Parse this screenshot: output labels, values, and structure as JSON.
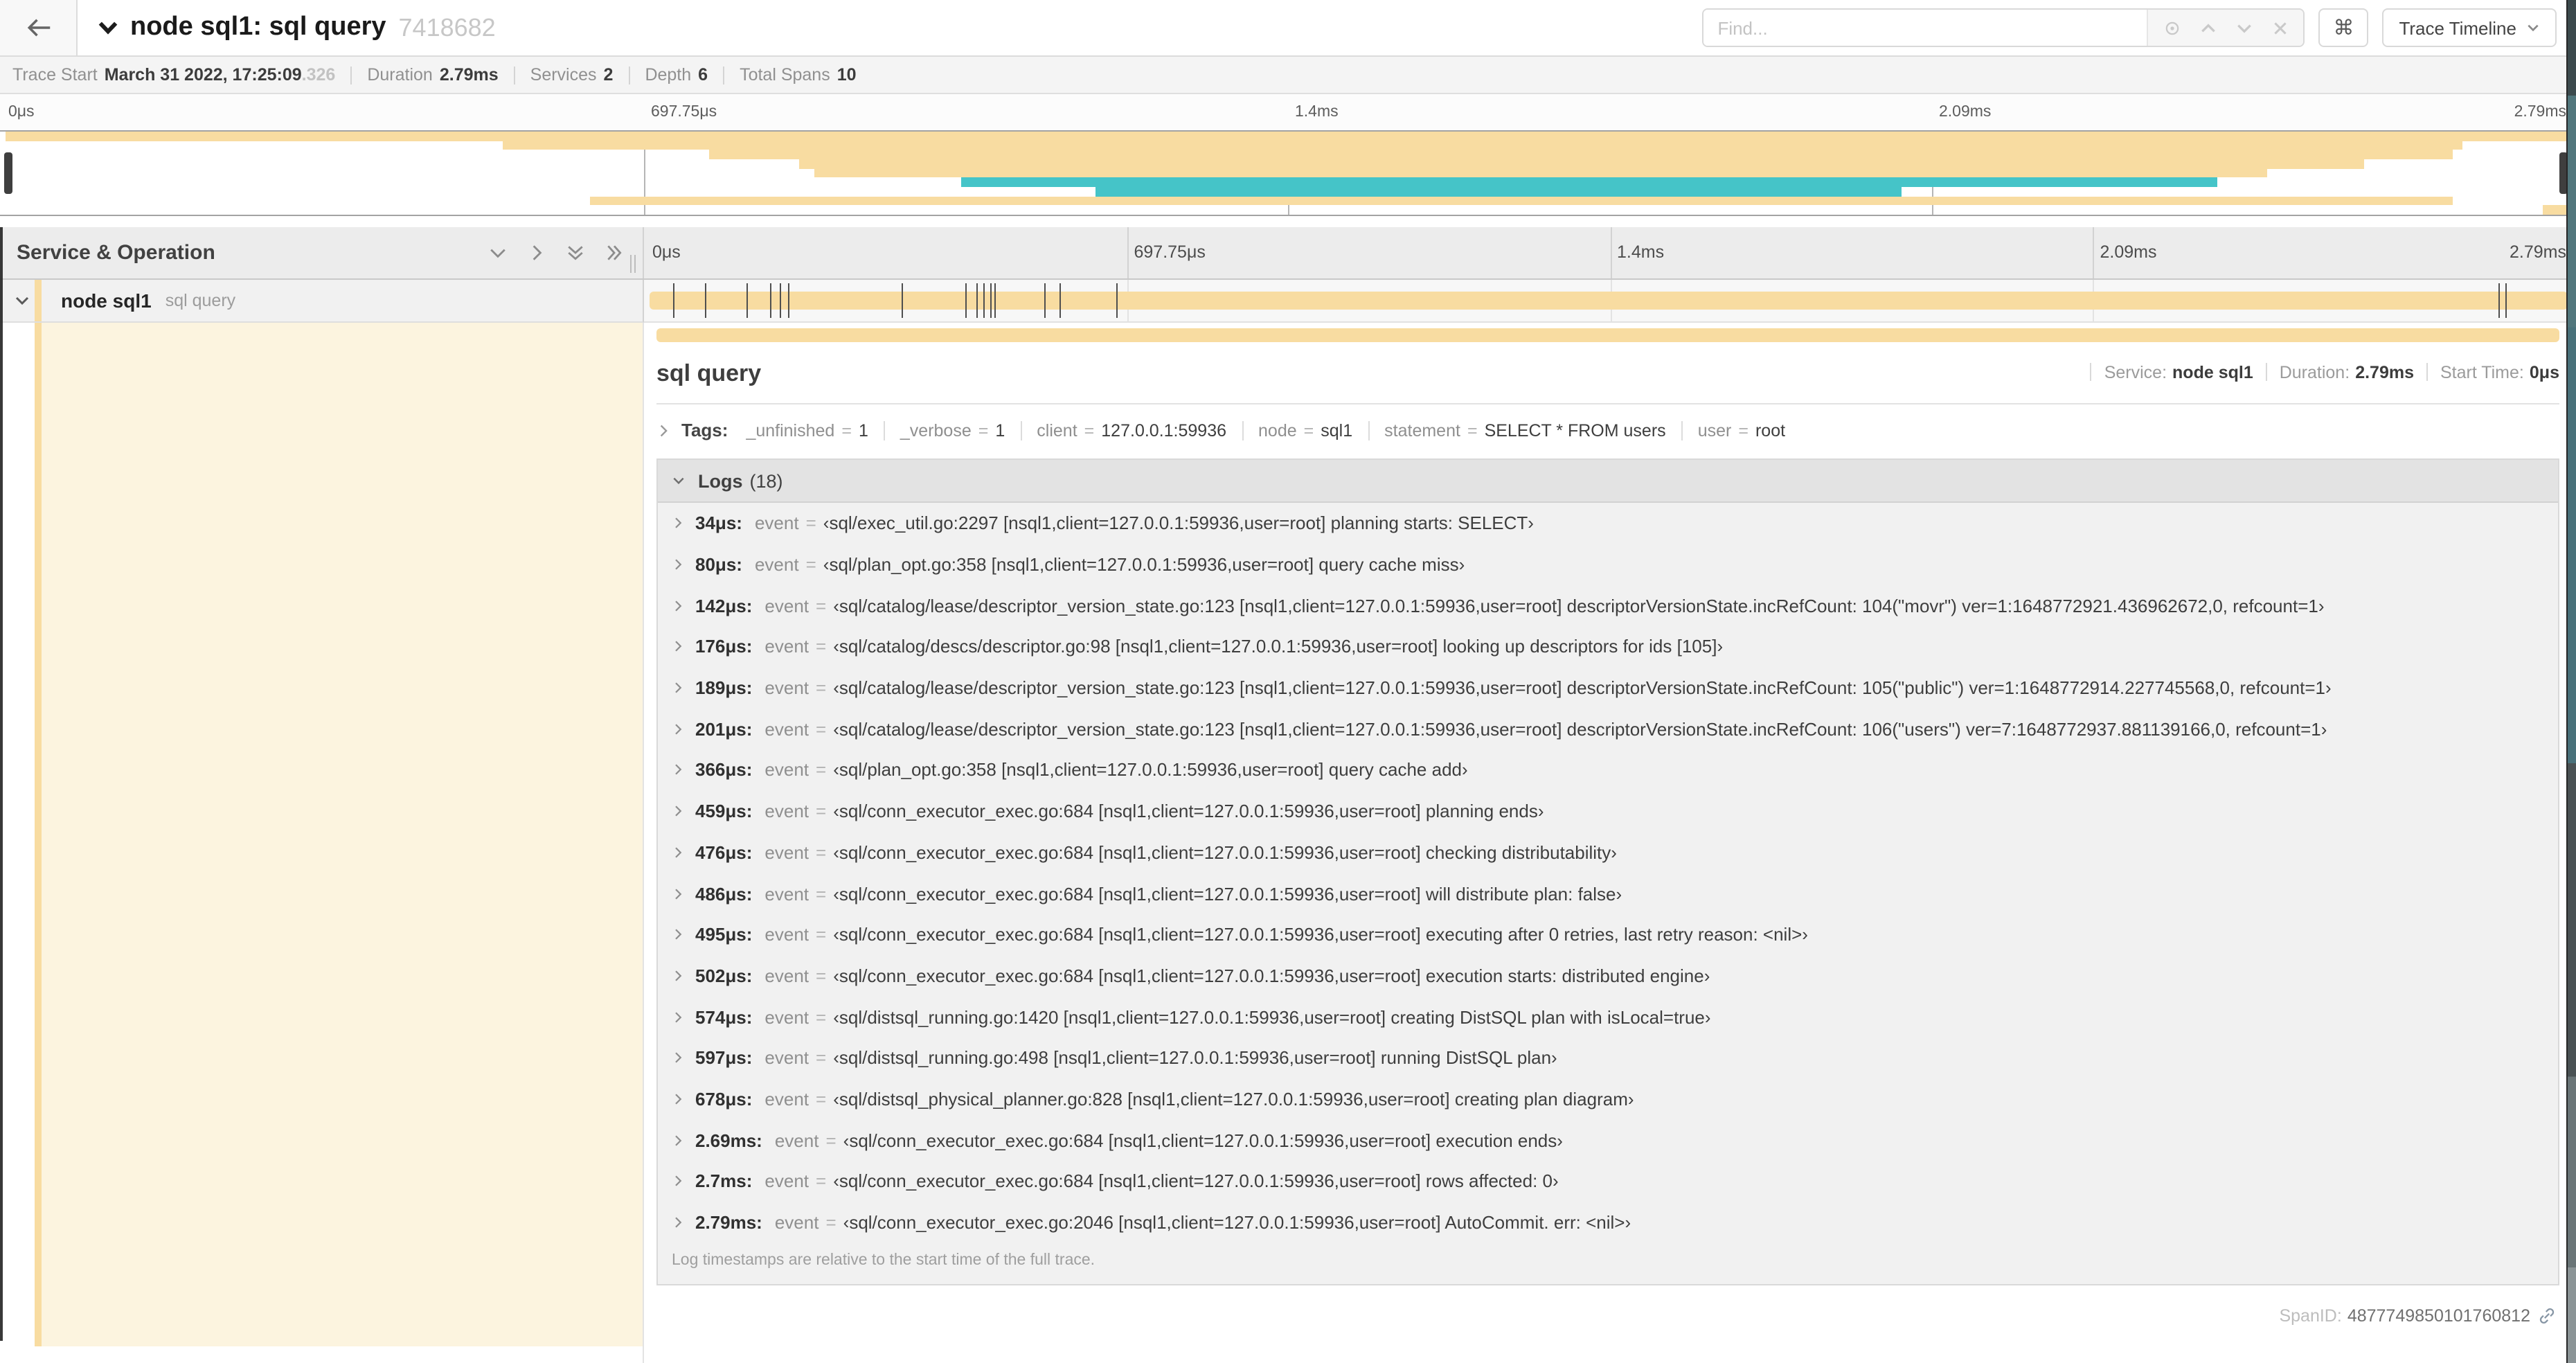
{
  "header": {
    "title_service": "node sql1: sql query",
    "trace_id_short": "7418682",
    "find_placeholder": "Find...",
    "keyboard_shortcut_label": "⌘",
    "view_selector_label": "Trace Timeline"
  },
  "summary": {
    "items": [
      {
        "label": "Trace Start",
        "value": "March 31 2022, 17:25:09",
        "suffix": ".326"
      },
      {
        "label": "Duration",
        "value": "2.79ms",
        "suffix": ""
      },
      {
        "label": "Services",
        "value": "2",
        "suffix": ""
      },
      {
        "label": "Depth",
        "value": "6",
        "suffix": ""
      },
      {
        "label": "Total Spans",
        "value": "10",
        "suffix": ""
      }
    ]
  },
  "timeline_ticks": [
    {
      "label": "0μs",
      "pct": 0
    },
    {
      "label": "697.75μs",
      "pct": 25
    },
    {
      "label": "1.4ms",
      "pct": 50
    },
    {
      "label": "2.09ms",
      "pct": 75
    },
    {
      "label": "2.79ms",
      "pct": 100
    }
  ],
  "colors": {
    "tan": "#f8dca1",
    "teal": "#45c4c8",
    "tan_faint": "#fcf4df"
  },
  "minimap": {
    "spans": [
      {
        "color": "tan",
        "start": 0.2,
        "end": 99.8
      },
      {
        "color": "tan",
        "start": 19.5,
        "end": 95.6
      },
      {
        "color": "tan",
        "start": 27.5,
        "end": 95.2
      },
      {
        "color": "tan",
        "start": 31.0,
        "end": 91.8
      },
      {
        "color": "tan",
        "start": 31.6,
        "end": 88.0
      },
      {
        "color": "teal",
        "start": 37.3,
        "end": 86.1
      },
      {
        "color": "teal",
        "start": 42.5,
        "end": 73.8
      },
      {
        "color": "tan",
        "start": 22.9,
        "end": 95.2
      },
      {
        "color": "tan",
        "start": 98.7,
        "end": 99.8
      }
    ]
  },
  "span_list": {
    "header_label": "Service & Operation",
    "row": {
      "service": "node sql1",
      "operation": "sql query"
    }
  },
  "trace": {
    "duration_us": 2790
  },
  "detail": {
    "title": "sql query",
    "meta": [
      {
        "label": "Service:",
        "value": "node sql1"
      },
      {
        "label": "Duration:",
        "value": "2.79ms"
      },
      {
        "label": "Start Time:",
        "value": "0μs"
      }
    ],
    "tags_label": "Tags:",
    "tags": [
      {
        "key": "_unfinished",
        "eq": "=",
        "value": "1"
      },
      {
        "key": "_verbose",
        "eq": "=",
        "value": "1"
      },
      {
        "key": "client",
        "eq": "=",
        "value": "127.0.0.1:59936"
      },
      {
        "key": "node",
        "eq": "=",
        "value": "sql1"
      },
      {
        "key": "statement",
        "eq": "=",
        "value": "SELECT * FROM users"
      },
      {
        "key": "user",
        "eq": "=",
        "value": "root"
      }
    ],
    "logs_label": "Logs",
    "logs_count": "(18)",
    "logs": [
      {
        "t": "34μs:",
        "t_us": 34,
        "key": "event",
        "eq": "=",
        "value": "‹sql/exec_util.go:2297 [nsql1,client=127.0.0.1:59936,user=root] planning starts: SELECT›"
      },
      {
        "t": "80μs:",
        "t_us": 80,
        "key": "event",
        "eq": "=",
        "value": "‹sql/plan_opt.go:358 [nsql1,client=127.0.0.1:59936,user=root] query cache miss›"
      },
      {
        "t": "142μs:",
        "t_us": 142,
        "key": "event",
        "eq": "=",
        "value": "‹sql/catalog/lease/descriptor_version_state.go:123 [nsql1,client=127.0.0.1:59936,user=root] descriptorVersionState.incRefCount: 104(\"movr\") ver=1:1648772921.436962672,0, refcount=1›"
      },
      {
        "t": "176μs:",
        "t_us": 176,
        "key": "event",
        "eq": "=",
        "value": "‹sql/catalog/descs/descriptor.go:98 [nsql1,client=127.0.0.1:59936,user=root] looking up descriptors for ids [105]›"
      },
      {
        "t": "189μs:",
        "t_us": 189,
        "key": "event",
        "eq": "=",
        "value": "‹sql/catalog/lease/descriptor_version_state.go:123 [nsql1,client=127.0.0.1:59936,user=root] descriptorVersionState.incRefCount: 105(\"public\") ver=1:1648772914.227745568,0, refcount=1›"
      },
      {
        "t": "201μs:",
        "t_us": 201,
        "key": "event",
        "eq": "=",
        "value": "‹sql/catalog/lease/descriptor_version_state.go:123 [nsql1,client=127.0.0.1:59936,user=root] descriptorVersionState.incRefCount: 106(\"users\") ver=7:1648772937.881139166,0, refcount=1›"
      },
      {
        "t": "366μs:",
        "t_us": 366,
        "key": "event",
        "eq": "=",
        "value": "‹sql/plan_opt.go:358 [nsql1,client=127.0.0.1:59936,user=root] query cache add›"
      },
      {
        "t": "459μs:",
        "t_us": 459,
        "key": "event",
        "eq": "=",
        "value": "‹sql/conn_executor_exec.go:684 [nsql1,client=127.0.0.1:59936,user=root] planning ends›"
      },
      {
        "t": "476μs:",
        "t_us": 476,
        "key": "event",
        "eq": "=",
        "value": "‹sql/conn_executor_exec.go:684 [nsql1,client=127.0.0.1:59936,user=root] checking distributability›"
      },
      {
        "t": "486μs:",
        "t_us": 486,
        "key": "event",
        "eq": "=",
        "value": "‹sql/conn_executor_exec.go:684 [nsql1,client=127.0.0.1:59936,user=root] will distribute plan: false›"
      },
      {
        "t": "495μs:",
        "t_us": 495,
        "key": "event",
        "eq": "=",
        "value": "‹sql/conn_executor_exec.go:684 [nsql1,client=127.0.0.1:59936,user=root] executing after 0 retries, last retry reason: <nil>›"
      },
      {
        "t": "502μs:",
        "t_us": 502,
        "key": "event",
        "eq": "=",
        "value": "‹sql/conn_executor_exec.go:684 [nsql1,client=127.0.0.1:59936,user=root] execution starts: distributed engine›"
      },
      {
        "t": "574μs:",
        "t_us": 574,
        "key": "event",
        "eq": "=",
        "value": "‹sql/distsql_running.go:1420 [nsql1,client=127.0.0.1:59936,user=root] creating DistSQL plan with isLocal=true›"
      },
      {
        "t": "597μs:",
        "t_us": 597,
        "key": "event",
        "eq": "=",
        "value": "‹sql/distsql_running.go:498 [nsql1,client=127.0.0.1:59936,user=root] running DistSQL plan›"
      },
      {
        "t": "678μs:",
        "t_us": 678,
        "key": "event",
        "eq": "=",
        "value": "‹sql/distsql_physical_planner.go:828 [nsql1,client=127.0.0.1:59936,user=root] creating plan diagram›"
      },
      {
        "t": "2.69ms:",
        "t_us": 2690,
        "key": "event",
        "eq": "=",
        "value": "‹sql/conn_executor_exec.go:684 [nsql1,client=127.0.0.1:59936,user=root] execution ends›"
      },
      {
        "t": "2.7ms:",
        "t_us": 2700,
        "key": "event",
        "eq": "=",
        "value": "‹sql/conn_executor_exec.go:684 [nsql1,client=127.0.0.1:59936,user=root] rows affected: 0›"
      },
      {
        "t": "2.79ms:",
        "t_us": 2790,
        "key": "event",
        "eq": "=",
        "value": "‹sql/conn_executor_exec.go:2046 [nsql1,client=127.0.0.1:59936,user=root] AutoCommit. err: <nil>›"
      }
    ],
    "logs_note": "Log timestamps are relative to the start time of the full trace.",
    "span_id_label": "SpanID:",
    "span_id": "4877749850101760812"
  }
}
